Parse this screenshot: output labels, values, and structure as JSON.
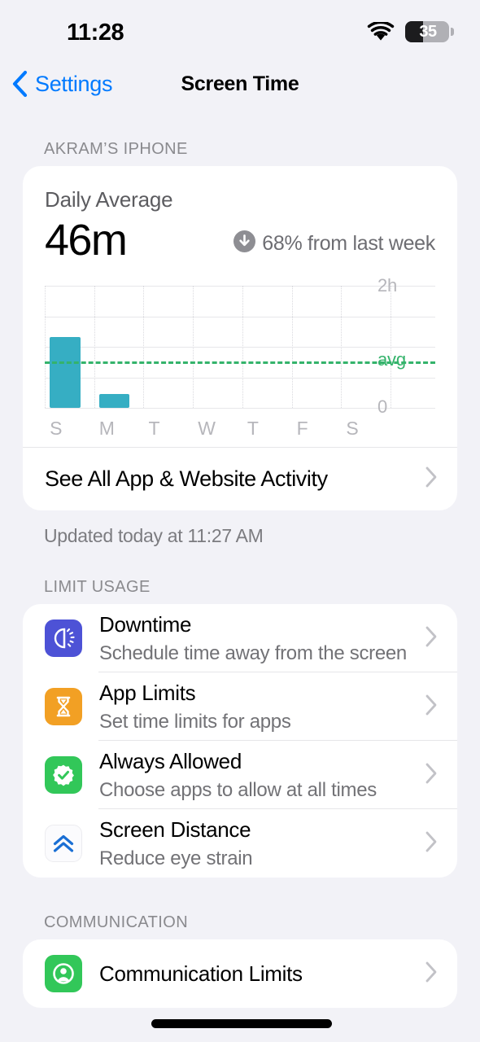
{
  "status_bar": {
    "time": "11:28",
    "wifi_icon": "wifi-icon",
    "battery_percent": "35",
    "battery_icon": "battery-icon"
  },
  "nav": {
    "back_label": "Settings",
    "back_icon": "chevron-left-icon",
    "title": "Screen Time"
  },
  "device_section": {
    "header": "AKRAM’S IPHONE"
  },
  "summary": {
    "daily_average_label": "Daily Average",
    "daily_average_value": "46m",
    "delta_icon": "arrow-down-circle-icon",
    "delta_text": "68% from last week"
  },
  "chart_data": {
    "type": "bar",
    "title": "Daily Average",
    "categories": [
      "S",
      "M",
      "T",
      "W",
      "T",
      "F",
      "S"
    ],
    "values": [
      70,
      14,
      0,
      0,
      0,
      0,
      0
    ],
    "unit": "minutes",
    "ylim": [
      0,
      120
    ],
    "ytick_labels": [
      "0",
      "2h"
    ],
    "average_line": {
      "label": "avg",
      "value": 46,
      "color": "#34b36b",
      "style": "dashed"
    },
    "bar_color": "#36aec3",
    "grid": true,
    "xlabel": "",
    "ylabel": "",
    "legend": "none"
  },
  "see_all": {
    "label": "See All App & Website Activity",
    "chevron_icon": "chevron-right-icon"
  },
  "updated_note": "Updated today at 11:27 AM",
  "limit_usage": {
    "header": "LIMIT USAGE",
    "rows": [
      {
        "title": "Downtime",
        "subtitle": "Schedule time away from the screen",
        "icon": "downtime-moon-icon",
        "icon_color": "#4d52d6",
        "chevron_icon": "chevron-right-icon"
      },
      {
        "title": "App Limits",
        "subtitle": "Set time limits for apps",
        "icon": "hourglass-icon",
        "icon_color": "#f2a024",
        "chevron_icon": "chevron-right-icon"
      },
      {
        "title": "Always Allowed",
        "subtitle": "Choose apps to allow at all times",
        "icon": "check-badge-icon",
        "icon_color": "#32c759",
        "chevron_icon": "chevron-right-icon"
      },
      {
        "title": "Screen Distance",
        "subtitle": "Reduce eye strain",
        "icon": "double-chevron-up-icon",
        "icon_color": "#1a6fd4",
        "chevron_icon": "chevron-right-icon"
      }
    ]
  },
  "communication": {
    "header": "COMMUNICATION",
    "rows": [
      {
        "title": "Communication Limits",
        "icon": "person-circle-icon",
        "icon_color": "#32c759",
        "chevron_icon": "chevron-right-icon"
      }
    ]
  }
}
